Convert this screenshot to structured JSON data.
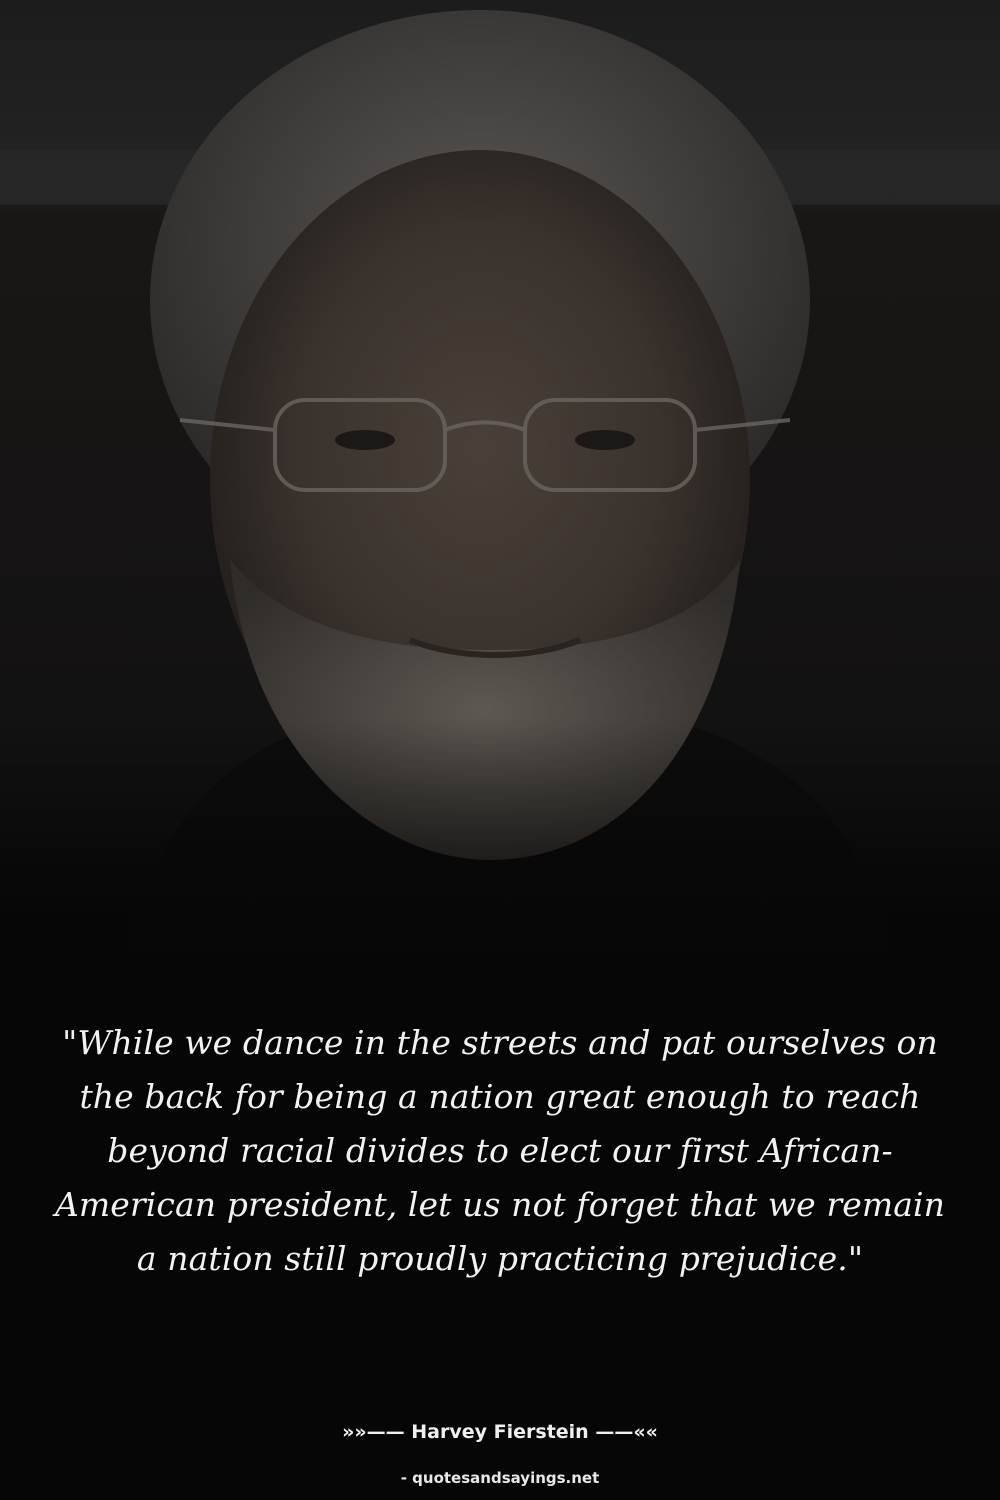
{
  "quote": {
    "text": "\"While we dance in the streets and pat ourselves on the back for being a nation great enough to reach beyond racial divides to elect our first African-American president, let us not forget that we remain a nation still proudly practicing prejudice.\""
  },
  "attribution": {
    "author_line": "»»—— Harvey Fierstein ——««"
  },
  "source": {
    "text": "- quotesandsayings.net"
  },
  "colors": {
    "background": "#0b0b0b",
    "text": "#f2f2f2"
  }
}
